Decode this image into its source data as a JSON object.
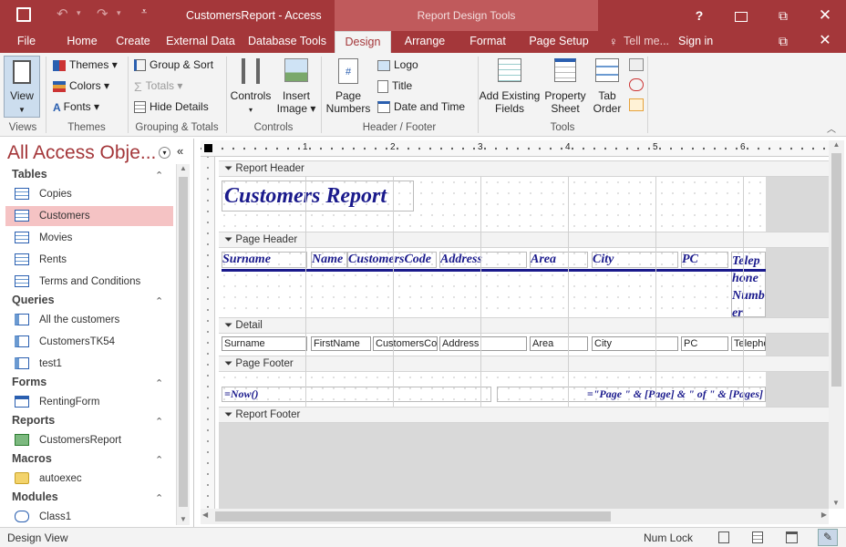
{
  "window": {
    "title": "CustomersReport - Access",
    "context_title": "Report Design Tools",
    "help": "?",
    "restore": "⧉",
    "close": "✕"
  },
  "tabs": [
    {
      "label": "File"
    },
    {
      "label": "Home"
    },
    {
      "label": "Create"
    },
    {
      "label": "External Data"
    },
    {
      "label": "Database Tools"
    },
    {
      "label": "Design"
    },
    {
      "label": "Arrange"
    },
    {
      "label": "Format"
    },
    {
      "label": "Page Setup"
    }
  ],
  "tell_me": "Tell me...",
  "sign_in": "Sign in",
  "ribbon": {
    "view": "View",
    "themes": "Themes",
    "colors": "Colors",
    "fonts": "Fonts",
    "group_sort": "Group & Sort",
    "totals": "Totals",
    "hide_details": "Hide Details",
    "controls": "Controls",
    "insert_image_1": "Insert",
    "insert_image_2": "Image",
    "page_numbers_1": "Page",
    "page_numbers_2": "Numbers",
    "logo": "Logo",
    "title": "Title",
    "date_time": "Date and Time",
    "add_existing_1": "Add Existing",
    "add_existing_2": "Fields",
    "property_1": "Property",
    "property_2": "Sheet",
    "tab_order_1": "Tab",
    "tab_order_2": "Order",
    "groups": {
      "views": "Views",
      "themes": "Themes",
      "grouping": "Grouping & Totals",
      "controls": "Controls",
      "header_footer": "Header / Footer",
      "tools": "Tools"
    }
  },
  "nav": {
    "header": "All Access Obje...",
    "groups": [
      {
        "label": "Tables",
        "items": [
          "Copies",
          "Customers",
          "Movies",
          "Rents",
          "Terms and Conditions"
        ]
      },
      {
        "label": "Queries",
        "items": [
          "All the customers",
          "CustomersTK54",
          "test1"
        ]
      },
      {
        "label": "Forms",
        "items": [
          "RentingForm"
        ]
      },
      {
        "label": "Reports",
        "items": [
          "CustomersReport"
        ]
      },
      {
        "label": "Macros",
        "items": [
          "autoexec"
        ]
      },
      {
        "label": "Modules",
        "items": [
          "Class1"
        ]
      }
    ]
  },
  "ruler": [
    "1",
    "2",
    "3",
    "4",
    "5",
    "6"
  ],
  "report": {
    "sections": {
      "report_header": "Report Header",
      "page_header": "Page Header",
      "detail": "Detail",
      "page_footer": "Page Footer",
      "report_footer": "Report Footer"
    },
    "title": "Customers Report",
    "header_labels": [
      "Surname",
      "Name",
      "CustomersCode",
      "Address",
      "Area",
      "City",
      "PC",
      "Telephone Number"
    ],
    "detail_fields": [
      "Surname",
      "FirstName",
      "CustomersCo",
      "Address",
      "Area",
      "City",
      "PC",
      "Telephc"
    ],
    "footer_left": "=Now()",
    "footer_right": "=\"Page \" & [Page] & \" of \" & [Pages]"
  },
  "status": {
    "view": "Design View",
    "num_lock": "Num Lock"
  },
  "colors": {
    "accent": "#a4373a",
    "label_text": "#1a1a8c",
    "selection": "#f5c3c4"
  }
}
